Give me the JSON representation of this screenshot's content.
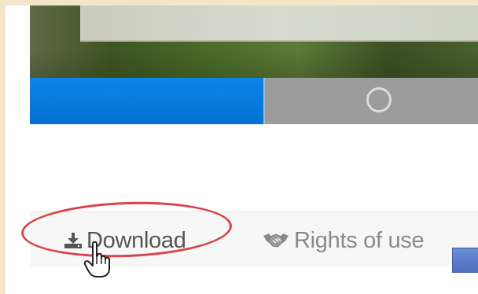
{
  "actions": {
    "download_label": "Download",
    "rights_label": "Rights of use"
  },
  "progress": {
    "fraction": 0.52
  },
  "icons": {
    "download": "download-icon",
    "rights": "handshake-icon",
    "cursor": "hand-pointer-cursor",
    "status": "circle-icon"
  },
  "colors": {
    "progress_fill": "#0a86e8",
    "progress_track": "#9c9c9c",
    "highlight": "#d9434a",
    "page_border": "#f3e6c8"
  }
}
